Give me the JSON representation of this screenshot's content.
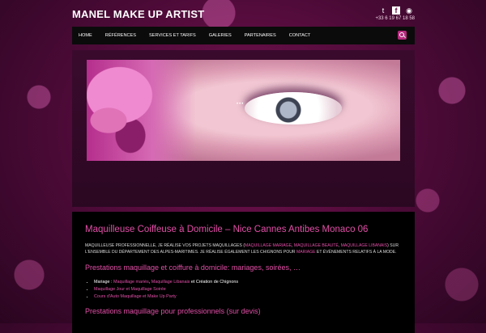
{
  "brand": "MANEL MAKE UP ARTIST",
  "social": {
    "phone": "+33 6 19 67 18 58"
  },
  "nav": {
    "items": [
      "HOME",
      "RÉFÉRENCES",
      "SERVICES ET TARIFS",
      "GALERIES",
      "PARTENAIRES",
      "CONTACT"
    ]
  },
  "content": {
    "title": "Maquilleuse Coiffeuse à Domicile – Nice Cannes Antibes Monaco 06",
    "intro_a": "MAQUILLEUSE PROFESSIONNELLE, JE RÉALISE VOS PROJETS MAQUILLAGES (",
    "intro_l1": "MAQUILLAGE MARIAGE",
    "intro_b": ", ",
    "intro_l2": "MAQUILLAGE BEAUTÉ",
    "intro_c": ", ",
    "intro_l3": "MAQUILLAGE LIBANAIS",
    "intro_d": ") SUR L'ENSEMBLE DU DÉPARTEMENT DES ALPES-MARITIMES. JE RÉALISE ÉGALEMENT LES CHIGNONS POUR ",
    "intro_l4": "MARIAGE",
    "intro_e": " ET ÉVÉNEMENTS RELATIFS À LA MODE.",
    "h2a": "Prestations maquillage et coiffure à domicile: mariages, soirées, …",
    "li1_a": "Mariage : ",
    "li1_l1": "Maquillage mariés",
    "li1_b": ", ",
    "li1_l2": "Maquillage Libanais",
    "li1_c": " et Création de Chignons",
    "li2_l1": "Maquillage Jour et Maquillage Soirée",
    "li3_l1": "Cours d'Auto Maquillage et Make Up Party",
    "h2b": "Prestations maquillage pour professionnels (sur devis)"
  }
}
